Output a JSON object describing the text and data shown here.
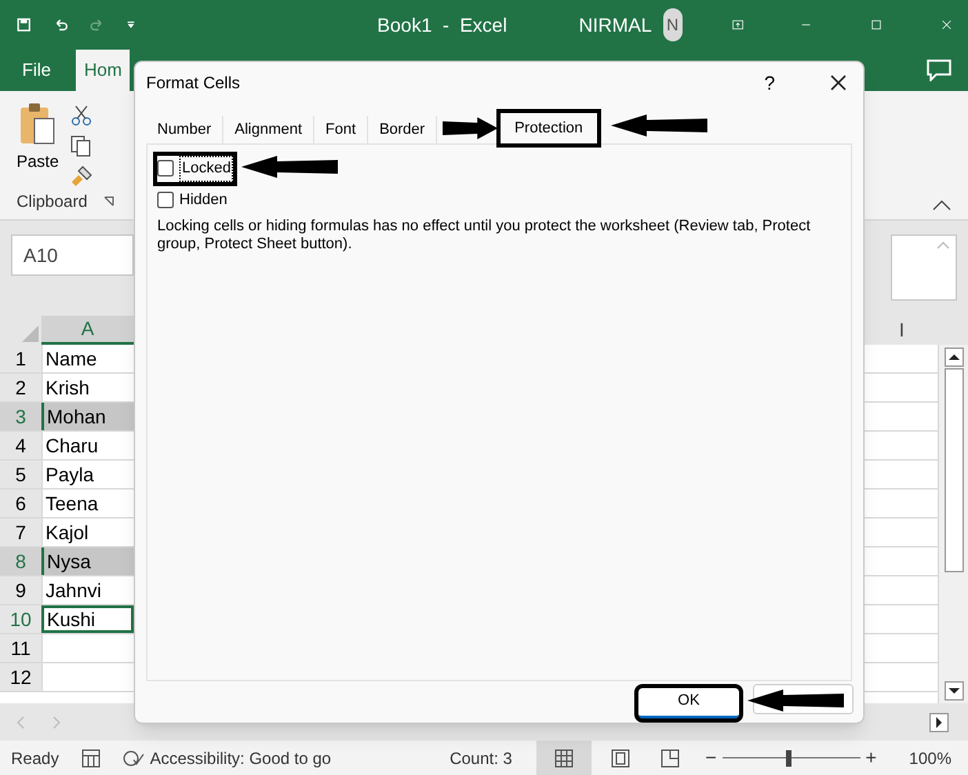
{
  "window": {
    "title": "Book1  -  Excel",
    "user": "NIRMAL",
    "avatar": "N"
  },
  "ribbon_tabs": [
    {
      "label": "File",
      "selected": false
    },
    {
      "label": "Hom",
      "selected": true
    }
  ],
  "ribbon": {
    "paste": "Paste",
    "group": "Clipboard"
  },
  "name_box": "A10",
  "columns": [
    "A",
    "I"
  ],
  "rows": [
    {
      "number": "1",
      "value": "Name",
      "selected": false,
      "active": false
    },
    {
      "number": "2",
      "value": "Krish",
      "selected": false,
      "active": false
    },
    {
      "number": "3",
      "value": "Mohan",
      "selected": true,
      "active": false
    },
    {
      "number": "4",
      "value": "Charu",
      "selected": false,
      "active": false
    },
    {
      "number": "5",
      "value": "Payla",
      "selected": false,
      "active": false
    },
    {
      "number": "6",
      "value": "Teena",
      "selected": false,
      "active": false
    },
    {
      "number": "7",
      "value": "Kajol",
      "selected": false,
      "active": false
    },
    {
      "number": "8",
      "value": "Nysa",
      "selected": true,
      "active": false
    },
    {
      "number": "9",
      "value": "Jahnvi",
      "selected": false,
      "active": false
    },
    {
      "number": "10",
      "value": "Kushi",
      "selected": false,
      "active": true
    },
    {
      "number": "11",
      "value": "",
      "selected": false,
      "active": false
    },
    {
      "number": "12",
      "value": "",
      "selected": false,
      "active": false
    }
  ],
  "status_bar": {
    "ready": "Ready",
    "accessibility": "Accessibility: Good to go",
    "count": "Count: 3",
    "zoom_out": "−",
    "zoom_in": "+",
    "zoom": "100%",
    "zoom_slider": {
      "level": 0.48
    }
  },
  "dialog": {
    "title": "Format Cells",
    "help": "?",
    "tabs": [
      {
        "label": "Number",
        "selected": false,
        "annotated": false
      },
      {
        "label": "Alignment",
        "selected": false,
        "annotated": false
      },
      {
        "label": "Font",
        "selected": false,
        "annotated": false
      },
      {
        "label": "Border",
        "selected": false,
        "annotated": false
      },
      {
        "label": "Protection",
        "selected": true,
        "annotated": true
      }
    ],
    "options": [
      {
        "label": "Locked",
        "checked": false,
        "annotated": true
      },
      {
        "label": "Hidden",
        "checked": false,
        "annotated": false
      }
    ],
    "note": "Locking cells or hiding formulas has no effect until you protect the worksheet (Review tab, Protect group, Protect Sheet button).",
    "buttons": [
      {
        "label": "OK",
        "annotated": true
      },
      {
        "annotated": false
      }
    ]
  }
}
